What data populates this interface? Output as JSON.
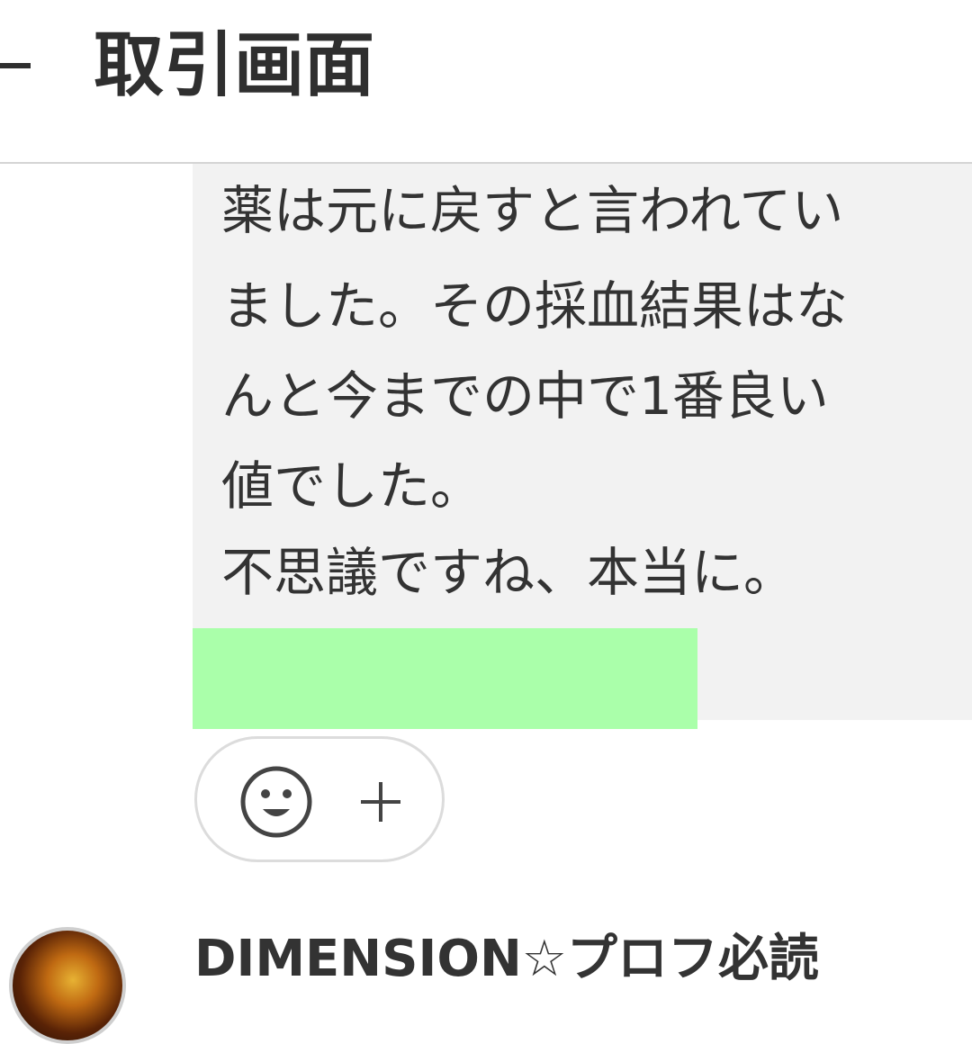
{
  "header": {
    "title": "取引画面"
  },
  "message": {
    "lines": [
      "薬は元に戻すと言われてい",
      "ました。その採血結果はな",
      "んと今までの中で1番良い",
      "値でした。",
      "不思議ですね、本当に。"
    ]
  },
  "icons": {
    "back": "back-icon",
    "reaction": "smiley-icon",
    "add": "plus-icon"
  },
  "user": {
    "name": "DIMENSION☆プロフ必読"
  },
  "colors": {
    "bubble_bg": "#f2f2f2",
    "redaction": "#aaffaa",
    "text": "#333333",
    "divider": "#d4d4d4"
  }
}
